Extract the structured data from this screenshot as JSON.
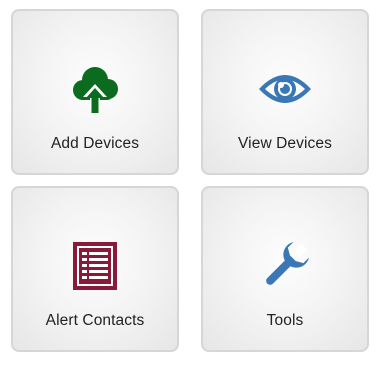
{
  "tiles": [
    {
      "label": "Add Devices",
      "icon": "cloud-upload-icon",
      "color": "#0b6b1e"
    },
    {
      "label": "View Devices",
      "icon": "eye-icon",
      "color": "#3a78b5"
    },
    {
      "label": "Alert Contacts",
      "icon": "contact-list-icon",
      "color": "#8b1a3a"
    },
    {
      "label": "Tools",
      "icon": "wrench-icon",
      "color": "#3a78b5"
    }
  ]
}
